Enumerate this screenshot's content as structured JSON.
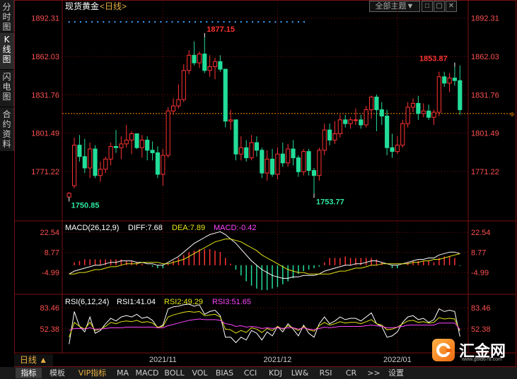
{
  "header": {
    "symbol": "现货黄金",
    "period": "<日线>",
    "theme_button": "全部主题▼",
    "win_buttons": [
      "□",
      "▢",
      "✕"
    ]
  },
  "left_tabs": [
    {
      "label": "分时图",
      "active": false
    },
    {
      "label": "K线图",
      "active": true
    },
    {
      "label": "闪电图",
      "active": false
    },
    {
      "label": "合约资料",
      "active": false
    }
  ],
  "colors": {
    "up": "#ff3333",
    "down": "#22dd99",
    "grid": "#7a1010",
    "axis_text_up": "#ff5050",
    "last_price_line": "#ff8c00",
    "diff": "#ffffff",
    "dea": "#e6e619",
    "macd": "#ff44ff",
    "rsi1": "#ffffff",
    "rsi2": "#e6e619",
    "rsi3": "#ff44ff"
  },
  "chart_data": [
    {
      "type": "candlestick",
      "title": "现货黄金 日线",
      "y_ticks": [
        "1892.31",
        "1862.03",
        "1831.76",
        "1801.49",
        "1771.22"
      ],
      "ylim": [
        1745.0,
        1895.5
      ],
      "x_labels": [
        "2021/11",
        "2021/12",
        "2022/01"
      ],
      "x_label_index": [
        18,
        40,
        63
      ],
      "annotations": {
        "high_1": "1877.15",
        "high_2": "1853.87",
        "low_1": "1750.85",
        "low_2": "1753.77"
      },
      "last_price": 1817.0,
      "ohlc": [
        [
          1751.0,
          1755.0,
          1750.85,
          1754.0
        ],
        [
          1760.0,
          1798.0,
          1758.0,
          1792.0
        ],
        [
          1792.0,
          1800.0,
          1779.0,
          1783.0
        ],
        [
          1783.0,
          1797.0,
          1770.0,
          1774.0
        ],
        [
          1774.0,
          1794.0,
          1766.0,
          1789.0
        ],
        [
          1789.0,
          1792.0,
          1766.0,
          1768.0
        ],
        [
          1768.0,
          1779.0,
          1763.0,
          1773.0
        ],
        [
          1773.0,
          1783.0,
          1770.0,
          1781.0
        ],
        [
          1781.0,
          1794.0,
          1776.0,
          1791.0
        ],
        [
          1791.0,
          1804.0,
          1786.0,
          1790.0
        ],
        [
          1790.0,
          1799.0,
          1781.0,
          1793.0
        ],
        [
          1793.0,
          1808.0,
          1790.0,
          1796.0
        ],
        [
          1796.0,
          1803.0,
          1785.0,
          1801.0
        ],
        [
          1801.0,
          1799.5,
          1789.0,
          1790.0
        ],
        [
          1790.0,
          1800.0,
          1782.0,
          1796.0
        ],
        [
          1796.0,
          1799.0,
          1780.0,
          1788.0
        ],
        [
          1788.0,
          1795.0,
          1780.0,
          1786.0
        ],
        [
          1786.0,
          1791.0,
          1766.0,
          1769.0
        ],
        [
          1769.0,
          1789.0,
          1760.0,
          1784.0
        ],
        [
          1784.0,
          1822.0,
          1782.0,
          1819.0
        ],
        [
          1819.0,
          1829.0,
          1816.0,
          1823.0
        ],
        [
          1823.0,
          1840.0,
          1821.0,
          1828.0
        ],
        [
          1828.0,
          1856.0,
          1826.0,
          1851.0
        ],
        [
          1851.0,
          1867.0,
          1848.0,
          1863.0
        ],
        [
          1863.0,
          1874.0,
          1855.0,
          1857.0
        ],
        [
          1857.0,
          1866.0,
          1853.0,
          1864.0
        ],
        [
          1864.0,
          1877.15,
          1849.0,
          1851.0
        ],
        [
          1851.0,
          1863.0,
          1846.0,
          1854.0
        ],
        [
          1854.0,
          1861.0,
          1844.0,
          1858.0
        ],
        [
          1858.0,
          1863.0,
          1850.0,
          1852.0
        ],
        [
          1852.0,
          1852.0,
          1806.0,
          1811.0
        ],
        [
          1811.0,
          1820.0,
          1804.0,
          1812.0
        ],
        [
          1812.0,
          1811.0,
          1780.0,
          1785.0
        ],
        [
          1785.0,
          1799.0,
          1780.0,
          1790.0
        ],
        [
          1790.0,
          1796.0,
          1779.0,
          1782.0
        ],
        [
          1782.0,
          1800.0,
          1780.0,
          1794.0
        ],
        [
          1794.0,
          1799.0,
          1783.0,
          1788.0
        ],
        [
          1788.0,
          1790.0,
          1766.0,
          1770.0
        ],
        [
          1770.0,
          1788.0,
          1764.0,
          1781.0
        ],
        [
          1781.0,
          1789.0,
          1767.0,
          1769.0
        ],
        [
          1769.0,
          1790.0,
          1765.0,
          1785.0
        ],
        [
          1785.0,
          1794.0,
          1775.0,
          1778.0
        ],
        [
          1778.0,
          1793.0,
          1775.0,
          1789.0
        ],
        [
          1789.0,
          1796.0,
          1776.0,
          1782.0
        ],
        [
          1782.0,
          1784.0,
          1767.0,
          1771.0
        ],
        [
          1771.0,
          1789.0,
          1768.0,
          1787.0
        ],
        [
          1787.0,
          1789.0,
          1768.0,
          1772.0
        ],
        [
          1772.0,
          1774.0,
          1753.77,
          1768.0
        ],
        [
          1768.0,
          1790.0,
          1764.0,
          1788.0
        ],
        [
          1788.0,
          1809.0,
          1784.0,
          1804.0
        ],
        [
          1804.0,
          1809.0,
          1792.0,
          1796.0
        ],
        [
          1796.0,
          1811.0,
          1793.0,
          1801.0
        ],
        [
          1801.0,
          1816.0,
          1798.0,
          1812.0
        ],
        [
          1812.0,
          1816.0,
          1806.0,
          1809.0
        ],
        [
          1809.0,
          1814.0,
          1805.0,
          1812.0
        ],
        [
          1812.0,
          1821.0,
          1808.0,
          1812.0
        ],
        [
          1812.0,
          1816.0,
          1805.0,
          1808.0
        ],
        [
          1808.0,
          1823.0,
          1806.0,
          1820.0
        ],
        [
          1820.0,
          1831.0,
          1813.0,
          1830.0
        ],
        [
          1830.0,
          1832.0,
          1803.0,
          1820.0
        ],
        [
          1820.0,
          1826.0,
          1808.0,
          1815.0
        ],
        [
          1815.0,
          1820.0,
          1784.0,
          1790.0
        ],
        [
          1790.0,
          1801.0,
          1782.0,
          1787.0
        ],
        [
          1787.0,
          1799.0,
          1785.0,
          1792.0
        ],
        [
          1792.0,
          1812.0,
          1790.0,
          1809.0
        ],
        [
          1809.0,
          1826.0,
          1806.0,
          1822.0
        ],
        [
          1822.0,
          1829.0,
          1818.0,
          1825.0
        ],
        [
          1825.0,
          1831.0,
          1812.0,
          1817.0
        ],
        [
          1817.0,
          1825.0,
          1814.0,
          1819.0
        ],
        [
          1819.0,
          1824.0,
          1812.0,
          1814.0
        ],
        [
          1814.0,
          1820.0,
          1808.0,
          1818.0
        ],
        [
          1818.0,
          1850.0,
          1815.0,
          1846.0
        ],
        [
          1846.0,
          1850.0,
          1838.0,
          1841.0
        ],
        [
          1841.0,
          1849.0,
          1834.0,
          1845.0
        ],
        [
          1845.0,
          1853.87,
          1839.0,
          1843.0
        ],
        [
          1843.0,
          1855.0,
          1816.0,
          1820.0
        ]
      ]
    },
    {
      "type": "macd",
      "title": "MACD(26,12,9)",
      "values": {
        "DIFF": "7.68",
        "DEA": "7.89",
        "MACD": "-0.42"
      },
      "y_ticks": [
        "22.54",
        "8.77",
        "-4.99"
      ],
      "ylim": [
        -18.0,
        27.0
      ],
      "diff": [
        -6,
        -4,
        -3,
        -2,
        -1,
        0,
        0,
        1,
        2,
        2,
        3,
        3,
        3,
        2,
        2,
        1,
        1,
        0,
        0,
        2,
        4,
        6,
        9,
        12,
        15,
        17,
        19,
        21,
        22,
        23,
        21,
        18,
        15,
        11,
        7,
        3,
        0,
        -3,
        -5,
        -7,
        -8,
        -9,
        -9,
        -8,
        -8,
        -7,
        -7,
        -7,
        -6,
        -4,
        -3,
        -2,
        -1,
        0,
        0,
        1,
        1,
        2,
        3,
        3,
        2,
        1,
        0,
        0,
        1,
        2,
        3,
        4,
        4,
        5,
        5,
        7,
        8,
        9,
        9,
        8
      ],
      "dea": [
        -6,
        -6,
        -5,
        -5,
        -4,
        -3,
        -3,
        -2,
        -1,
        -1,
        0,
        1,
        1,
        1,
        2,
        2,
        2,
        2,
        1,
        1,
        2,
        3,
        4,
        6,
        8,
        10,
        12,
        14,
        16,
        17,
        18,
        18,
        17,
        16,
        14,
        12,
        10,
        7,
        5,
        3,
        1,
        -1,
        -3,
        -4,
        -5,
        -5,
        -6,
        -6,
        -6,
        -6,
        -6,
        -5,
        -4,
        -4,
        -3,
        -2,
        -2,
        -1,
        0,
        0,
        1,
        1,
        1,
        1,
        1,
        1,
        2,
        2,
        3,
        3,
        4,
        4,
        5,
        6,
        7,
        7.9
      ],
      "macd": [
        0,
        2,
        3,
        4,
        4,
        4,
        4,
        4,
        4,
        4,
        4,
        3,
        3,
        2,
        1,
        0,
        -1,
        -2,
        -2,
        1,
        3,
        5,
        7,
        9,
        10,
        11,
        11,
        11,
        10,
        9,
        5,
        1,
        -3,
        -7,
        -11,
        -14,
        -16,
        -17,
        -17,
        -16,
        -15,
        -13,
        -11,
        -9,
        -6,
        -4,
        -3,
        -2,
        -1,
        2,
        5,
        5,
        5,
        6,
        5,
        5,
        5,
        5,
        5,
        4,
        2,
        0,
        -2,
        -2,
        0,
        2,
        3,
        3,
        3,
        3,
        2,
        5,
        6,
        6,
        5,
        -0.42
      ]
    },
    {
      "type": "rsi",
      "title": "RSI(6,12,24)",
      "values": {
        "RSI1": "41.04",
        "RSI2": "49.29",
        "RSI3": "51.65"
      },
      "y_ticks": [
        "83.46",
        "52.38"
      ],
      "ylim": [
        20.0,
        92.0
      ],
      "rsi1": [
        30,
        78,
        56,
        48,
        70,
        46,
        50,
        60,
        68,
        64,
        70,
        72,
        70,
        74,
        68,
        70,
        65,
        54,
        58,
        82,
        85,
        86,
        88,
        89,
        86,
        88,
        74,
        78,
        80,
        72,
        40,
        40,
        32,
        40,
        36,
        50,
        46,
        36,
        48,
        42,
        56,
        48,
        60,
        52,
        42,
        58,
        46,
        40,
        60,
        70,
        60,
        64,
        70,
        66,
        68,
        68,
        64,
        70,
        76,
        60,
        56,
        40,
        42,
        48,
        62,
        70,
        72,
        66,
        68,
        62,
        66,
        82,
        78,
        80,
        78,
        41
      ],
      "rsi2": [
        40,
        62,
        56,
        52,
        62,
        50,
        52,
        56,
        62,
        60,
        63,
        64,
        63,
        65,
        62,
        63,
        61,
        55,
        56,
        70,
        73,
        75,
        77,
        78,
        77,
        78,
        72,
        73,
        74,
        70,
        52,
        51,
        46,
        50,
        47,
        54,
        52,
        47,
        53,
        50,
        56,
        52,
        57,
        54,
        50,
        56,
        51,
        49,
        57,
        62,
        58,
        60,
        63,
        61,
        62,
        62,
        60,
        63,
        66,
        60,
        58,
        51,
        52,
        55,
        60,
        64,
        65,
        62,
        63,
        61,
        62,
        69,
        67,
        68,
        67,
        49.29
      ],
      "rsi3": [
        50,
        53,
        53,
        52,
        54,
        52,
        52,
        53,
        54,
        54,
        54,
        55,
        55,
        55,
        55,
        55,
        55,
        54,
        54,
        57,
        59,
        61,
        63,
        65,
        66,
        67,
        66,
        66,
        66,
        65,
        60,
        59,
        56,
        57,
        55,
        56,
        55,
        53,
        54,
        53,
        54,
        53,
        54,
        54,
        52,
        54,
        52,
        51,
        53,
        55,
        54,
        55,
        56,
        56,
        56,
        56,
        56,
        57,
        58,
        57,
        56,
        54,
        54,
        55,
        56,
        58,
        58,
        58,
        58,
        58,
        58,
        61,
        61,
        61,
        61,
        51.65
      ]
    }
  ],
  "bottom_tabs": [
    "日线 ▲",
    "指标",
    "模板",
    "VIP指标",
    "MA",
    "MACD",
    "BOLL",
    "VOL",
    "BIAS",
    "CCI",
    "KDJ",
    "LW&",
    "RSI",
    "CR",
    ">>",
    "设置"
  ],
  "logo": {
    "text": "汇金网",
    "url": "www.gold678.com"
  }
}
